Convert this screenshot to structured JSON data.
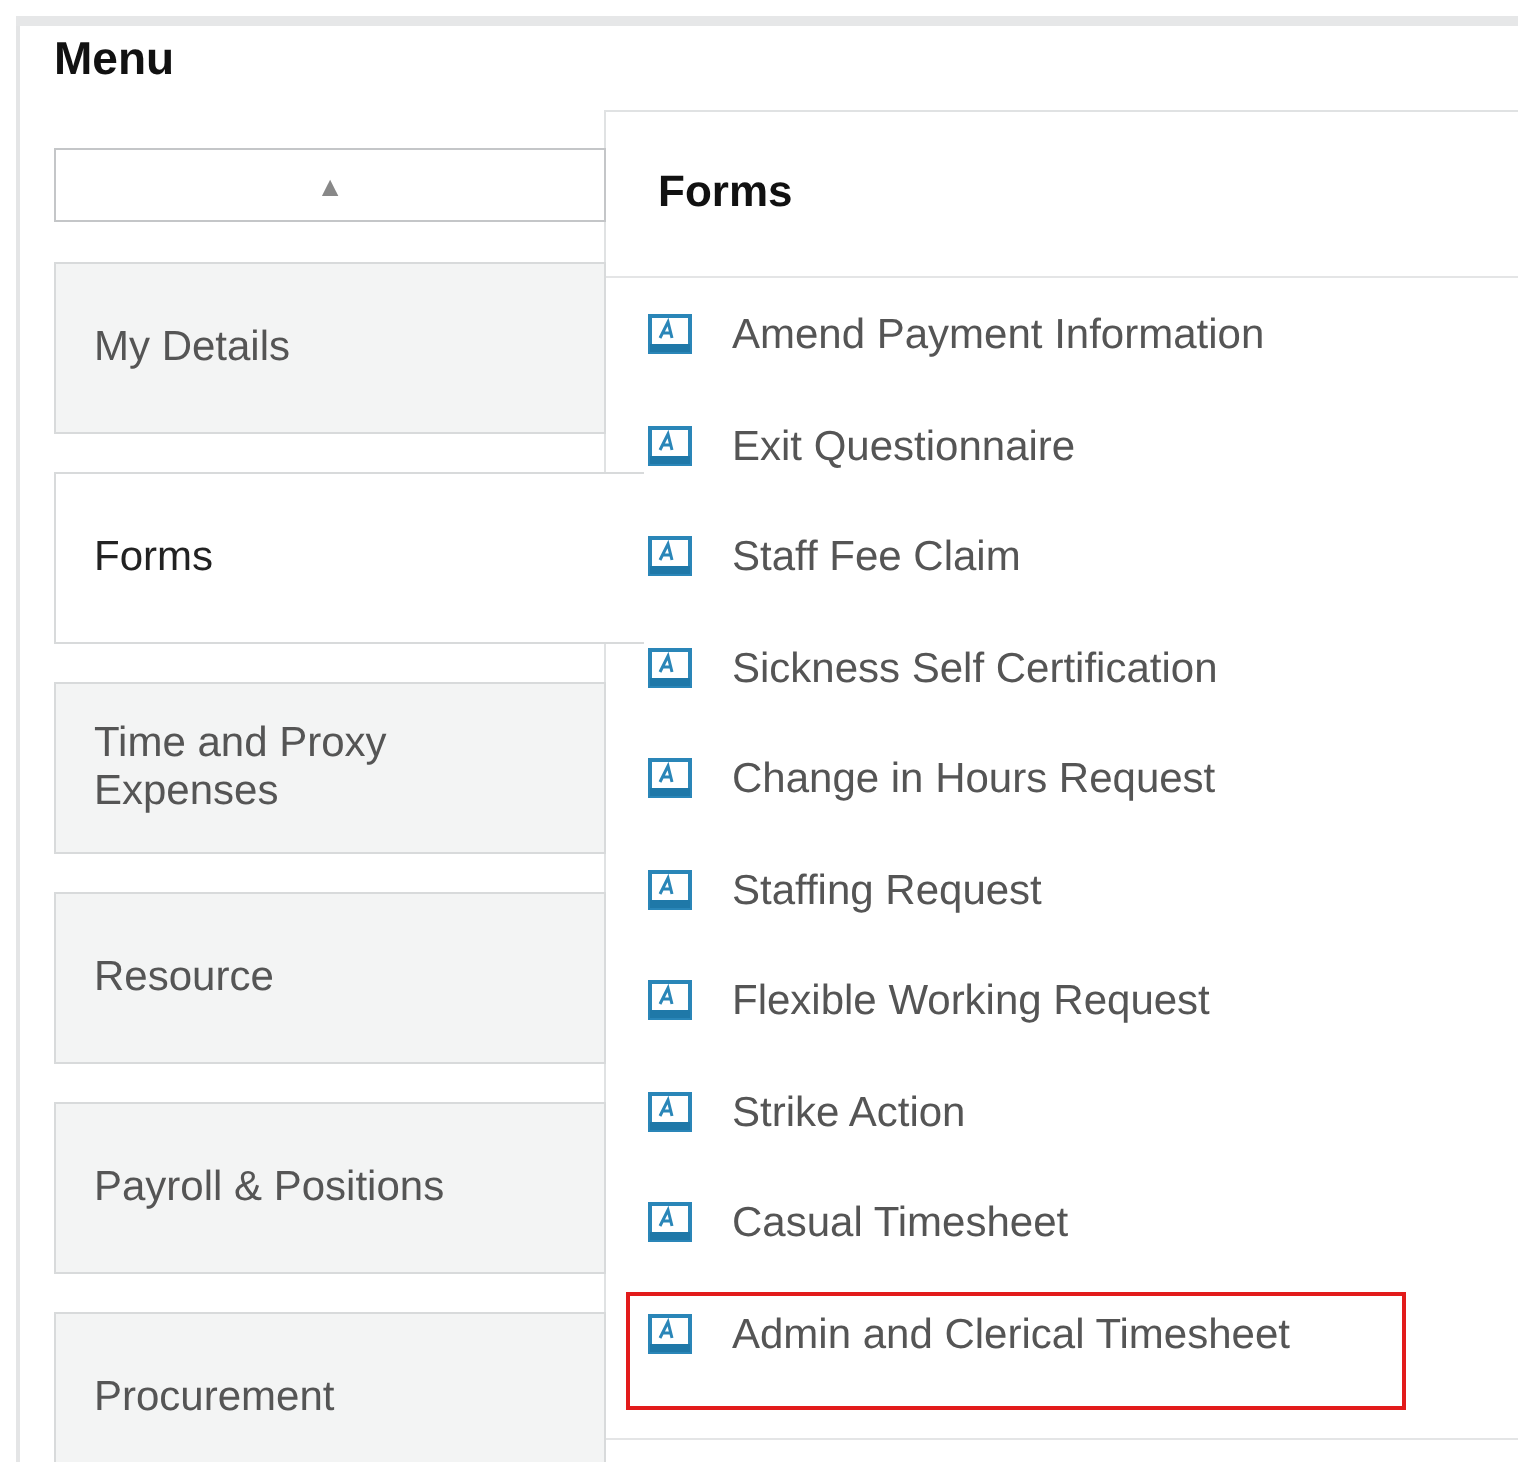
{
  "menu": {
    "title": "Menu",
    "scroll_up": "▲",
    "items": [
      {
        "label": "My Details",
        "selected": false
      },
      {
        "label": "Forms",
        "selected": true
      },
      {
        "label": "Time and Proxy Expenses",
        "selected": false
      },
      {
        "label": "Resource",
        "selected": false
      },
      {
        "label": "Payroll & Positions",
        "selected": false
      },
      {
        "label": "Procurement",
        "selected": false
      }
    ]
  },
  "forms": {
    "title": "Forms",
    "items": [
      {
        "label": "Amend Payment Information",
        "highlighted": false
      },
      {
        "label": "Exit Questionnaire",
        "highlighted": false
      },
      {
        "label": "Staff Fee Claim",
        "highlighted": false
      },
      {
        "label": "Sickness Self Certification",
        "highlighted": false
      },
      {
        "label": "Change in Hours Request",
        "highlighted": false
      },
      {
        "label": "Staffing Request",
        "highlighted": false
      },
      {
        "label": "Flexible Working Request",
        "highlighted": false
      },
      {
        "label": "Strike Action",
        "highlighted": false
      },
      {
        "label": "Casual Timesheet",
        "highlighted": false
      },
      {
        "label": "Admin and Clerical Timesheet",
        "highlighted": true
      }
    ]
  }
}
